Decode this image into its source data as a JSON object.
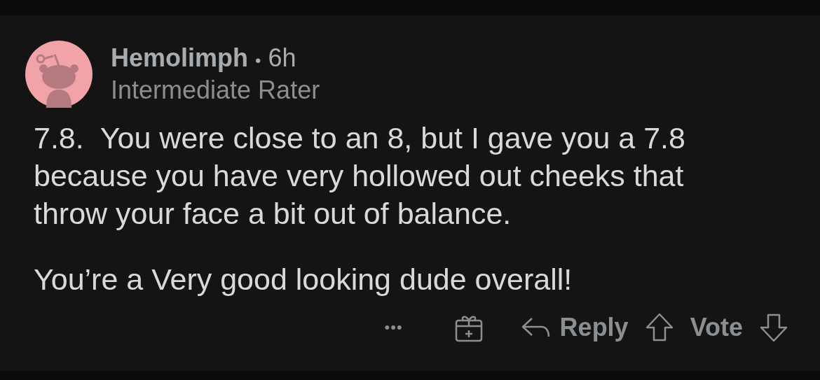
{
  "comment": {
    "author": "Hemolimph",
    "separator": "•",
    "age": "6h",
    "flair": "Intermediate Rater",
    "paragraphs": [
      "7.8.  You were close to an 8, but I gave you a 7.8 because you have very hollowed out cheeks that throw your face a bit out of balance.",
      "You’re a Very good looking dude overall!"
    ]
  },
  "actions": {
    "more": "•••",
    "reply": "Reply",
    "vote": "Vote"
  }
}
